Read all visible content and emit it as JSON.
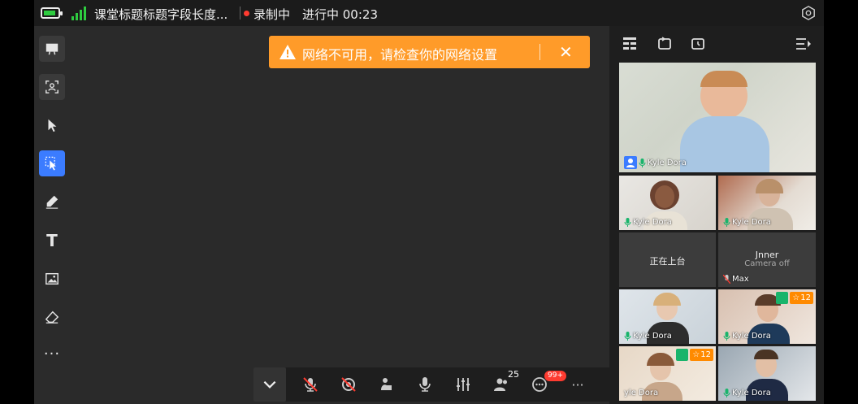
{
  "status_bar": {
    "class_title": "课堂标题标题字段长度...",
    "recording_label": "录制中",
    "progress_label": "进行中 00:23",
    "colors": {
      "battery": "#2ecc40",
      "signal": "#2ecc40",
      "recording_dot": "#ff3b30"
    }
  },
  "toolbar": {
    "items": [
      "whiteboard-icon",
      "screen-share-icon",
      "pointer-icon",
      "select-icon",
      "pen-icon",
      "text-tool",
      "image-icon",
      "eraser-icon",
      "more-tools"
    ],
    "text_tool_label": "T",
    "more_label": "···",
    "active_item": "select-icon",
    "accent": "#3b7cff"
  },
  "toast": {
    "message": "网络不可用，请检查你的网络设置",
    "close_label": "✕",
    "color": "#ff9b29"
  },
  "controls": {
    "participants_count": "25",
    "chat_unread": "99+",
    "more_label": "···",
    "hangup_color": "#ff3b30"
  },
  "panel": {
    "header_icons": [
      "layout-icon",
      "switch-view-icon",
      "rotate-view-icon",
      "collapse-panel-icon"
    ],
    "tiles": [
      {
        "name": "Kyle Dora",
        "type": "host-video"
      },
      {
        "name": "Kyle Dora",
        "type": "video"
      },
      {
        "name": "Kyle Dora",
        "type": "video"
      },
      {
        "status": "正在上台",
        "type": "status"
      },
      {
        "title": "Jnner",
        "subtitle": "Camera off",
        "name": "Max",
        "type": "camera-off"
      },
      {
        "name": "Kyle Dora",
        "type": "video"
      },
      {
        "name": "Kyle Dora",
        "type": "video",
        "reward": "12"
      },
      {
        "name": "yle Dora",
        "type": "video",
        "reward": "12"
      },
      {
        "name": "Kyle Dora",
        "type": "video"
      }
    ]
  }
}
